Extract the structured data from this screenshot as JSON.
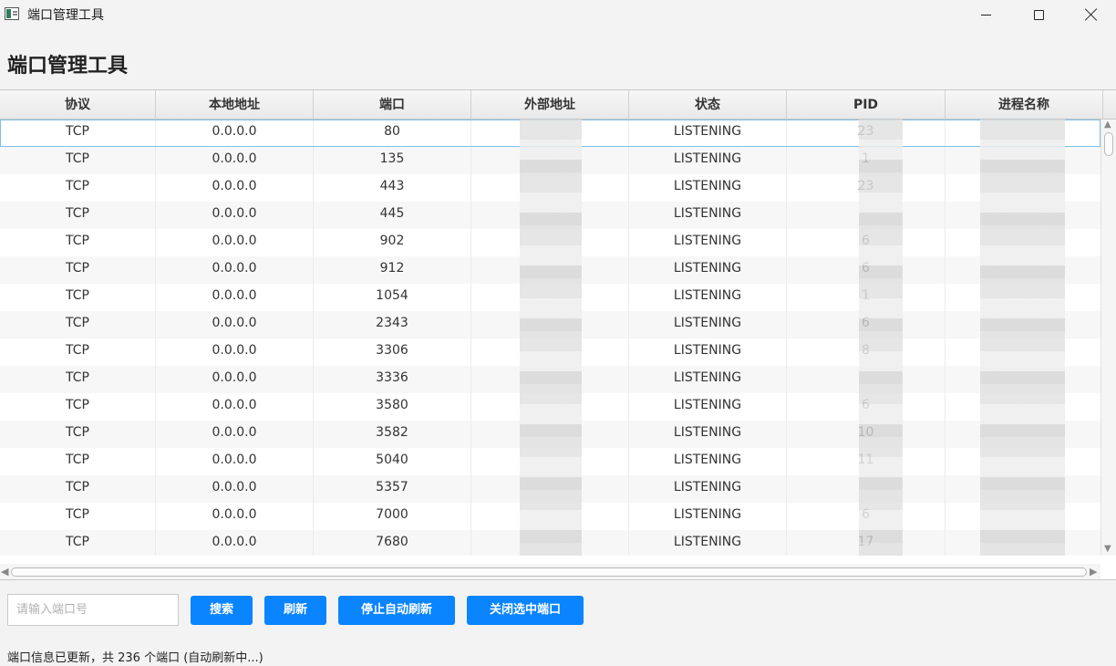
{
  "window": {
    "title": "端口管理工具"
  },
  "page": {
    "title": "端口管理工具"
  },
  "table": {
    "columns": [
      "协议",
      "本地地址",
      "端口",
      "外部地址",
      "状态",
      "PID",
      "进程名称"
    ],
    "rows": [
      {
        "protocol": "TCP",
        "local": "0.0.0.0",
        "port": "80",
        "state": "LISTENING",
        "pid": "23"
      },
      {
        "protocol": "TCP",
        "local": "0.0.0.0",
        "port": "135",
        "state": "LISTENING",
        "pid": "1"
      },
      {
        "protocol": "TCP",
        "local": "0.0.0.0",
        "port": "443",
        "state": "LISTENING",
        "pid": "23"
      },
      {
        "protocol": "TCP",
        "local": "0.0.0.0",
        "port": "445",
        "state": "LISTENING",
        "pid": ""
      },
      {
        "protocol": "TCP",
        "local": "0.0.0.0",
        "port": "902",
        "state": "LISTENING",
        "pid": "6"
      },
      {
        "protocol": "TCP",
        "local": "0.0.0.0",
        "port": "912",
        "state": "LISTENING",
        "pid": "6"
      },
      {
        "protocol": "TCP",
        "local": "0.0.0.0",
        "port": "1054",
        "state": "LISTENING",
        "pid": "1"
      },
      {
        "protocol": "TCP",
        "local": "0.0.0.0",
        "port": "2343",
        "state": "LISTENING",
        "pid": "6"
      },
      {
        "protocol": "TCP",
        "local": "0.0.0.0",
        "port": "3306",
        "state": "LISTENING",
        "pid": "8"
      },
      {
        "protocol": "TCP",
        "local": "0.0.0.0",
        "port": "3336",
        "state": "LISTENING",
        "pid": ""
      },
      {
        "protocol": "TCP",
        "local": "0.0.0.0",
        "port": "3580",
        "state": "LISTENING",
        "pid": "6"
      },
      {
        "protocol": "TCP",
        "local": "0.0.0.0",
        "port": "3582",
        "state": "LISTENING",
        "pid": "10"
      },
      {
        "protocol": "TCP",
        "local": "0.0.0.0",
        "port": "5040",
        "state": "LISTENING",
        "pid": "11"
      },
      {
        "protocol": "TCP",
        "local": "0.0.0.0",
        "port": "5357",
        "state": "LISTENING",
        "pid": ""
      },
      {
        "protocol": "TCP",
        "local": "0.0.0.0",
        "port": "7000",
        "state": "LISTENING",
        "pid": "6"
      },
      {
        "protocol": "TCP",
        "local": "0.0.0.0",
        "port": "7680",
        "state": "LISTENING",
        "pid": "17"
      }
    ]
  },
  "controls": {
    "search_placeholder": "请输入端口号",
    "search_value": "",
    "search_button": "搜索",
    "refresh_button": "刷新",
    "stop_auto_refresh_button": "停止自动刷新",
    "close_port_button": "关闭选中端口"
  },
  "status": {
    "text": "端口信息已更新，共 236 个端口 (自动刷新中...)"
  },
  "colors": {
    "accent": "#0a84ff",
    "selection": "#7dc1e8"
  }
}
